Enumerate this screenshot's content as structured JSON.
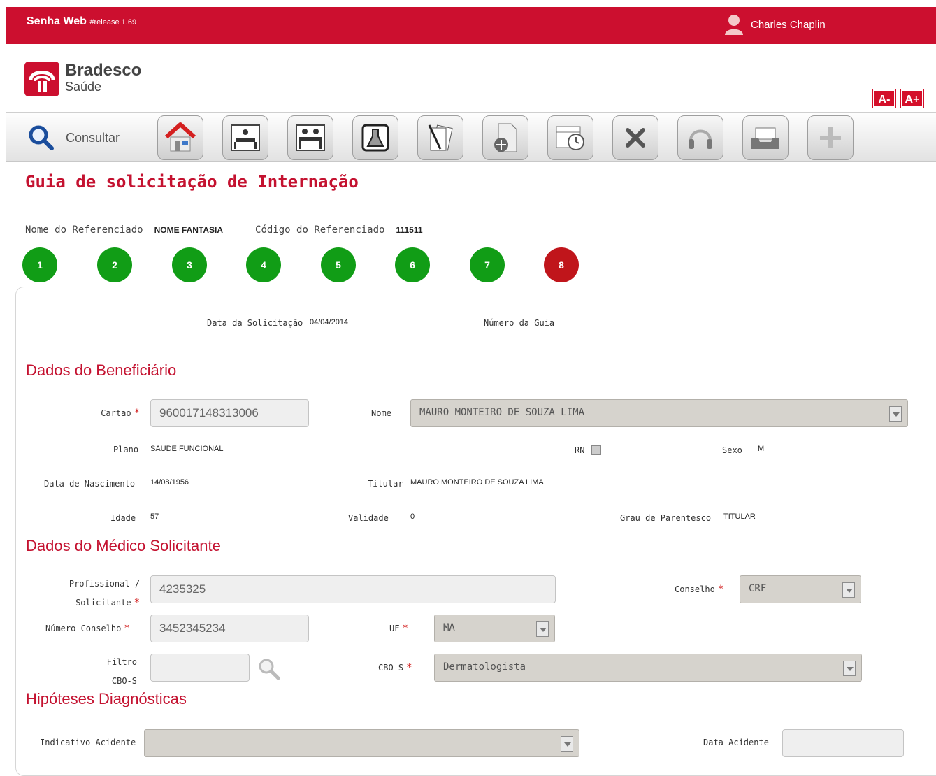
{
  "header": {
    "app_name": "Senha Web",
    "release": "#release 1.69",
    "user_name": "Charles Chaplin"
  },
  "logo": {
    "line1": "Bradesco",
    "line2": "Saúde"
  },
  "font_buttons": {
    "decrease": "A-",
    "increase": "A+"
  },
  "toolbar": {
    "consult_label": "Consultar",
    "buttons": [
      "home-icon",
      "hospital-bed-icon",
      "hospital-beds-icon",
      "lab-flask-icon",
      "documents-pen-icon",
      "document-add-icon",
      "calendar-clock-icon",
      "close-x-icon",
      "headset-icon",
      "tray-icon",
      "plus-icon"
    ]
  },
  "page": {
    "title": "Guia de solicitação de Internação",
    "ref_name_label": "Nome do Referenciado",
    "ref_name_value": "NOME FANTASIA",
    "ref_code_label": "Código do Referenciado",
    "ref_code_value": "111511"
  },
  "steps": [
    "1",
    "2",
    "3",
    "4",
    "5",
    "6",
    "7",
    "8"
  ],
  "request": {
    "date_label": "Data da Solicitação",
    "date_value": "04/04/2014",
    "guide_number_label": "Número da Guia"
  },
  "beneficiary": {
    "section_title": "Dados do Beneficiário",
    "card_label": "Cartao",
    "card_value": "960017148313006",
    "name_label": "Nome",
    "name_value": "MAURO MONTEIRO DE SOUZA LIMA",
    "plan_label": "Plano",
    "plan_value": "SAUDE FUNCIONAL",
    "rn_label": "RN",
    "sex_label": "Sexo",
    "sex_value": "M",
    "birth_label": "Data de Nascimento",
    "birth_value": "14/08/1956",
    "holder_label": "Titular",
    "holder_value": "MAURO MONTEIRO DE SOUZA LIMA",
    "age_label": "Idade",
    "age_value": "57",
    "validity_label": "Validade",
    "validity_value": "0",
    "kinship_label": "Grau de Parentesco",
    "kinship_value": "TITULAR"
  },
  "doctor": {
    "section_title": "Dados do Médico Solicitante",
    "professional_label_1": "Profissional /",
    "professional_label_2": "Solicitante",
    "professional_value": "4235325",
    "council_label": "Conselho",
    "council_value": "CRF",
    "council_number_label": "Número Conselho",
    "council_number_value": "3452345234",
    "uf_label": "UF",
    "uf_value": "MA",
    "filter_label_1": "Filtro",
    "filter_label_2": "CBO-S",
    "cbos_label": "CBO-S",
    "cbos_value": "Dermatologista"
  },
  "diagnosis": {
    "section_title": "Hipóteses Diagnósticas",
    "accident_indicator_label": "Indicativo Acidente",
    "accident_indicator_value": "",
    "accident_date_label": "Data Acidente"
  },
  "colors": {
    "brand_red": "#cc0f2f",
    "step_green": "#119d16",
    "step_active": "#c0151b"
  }
}
